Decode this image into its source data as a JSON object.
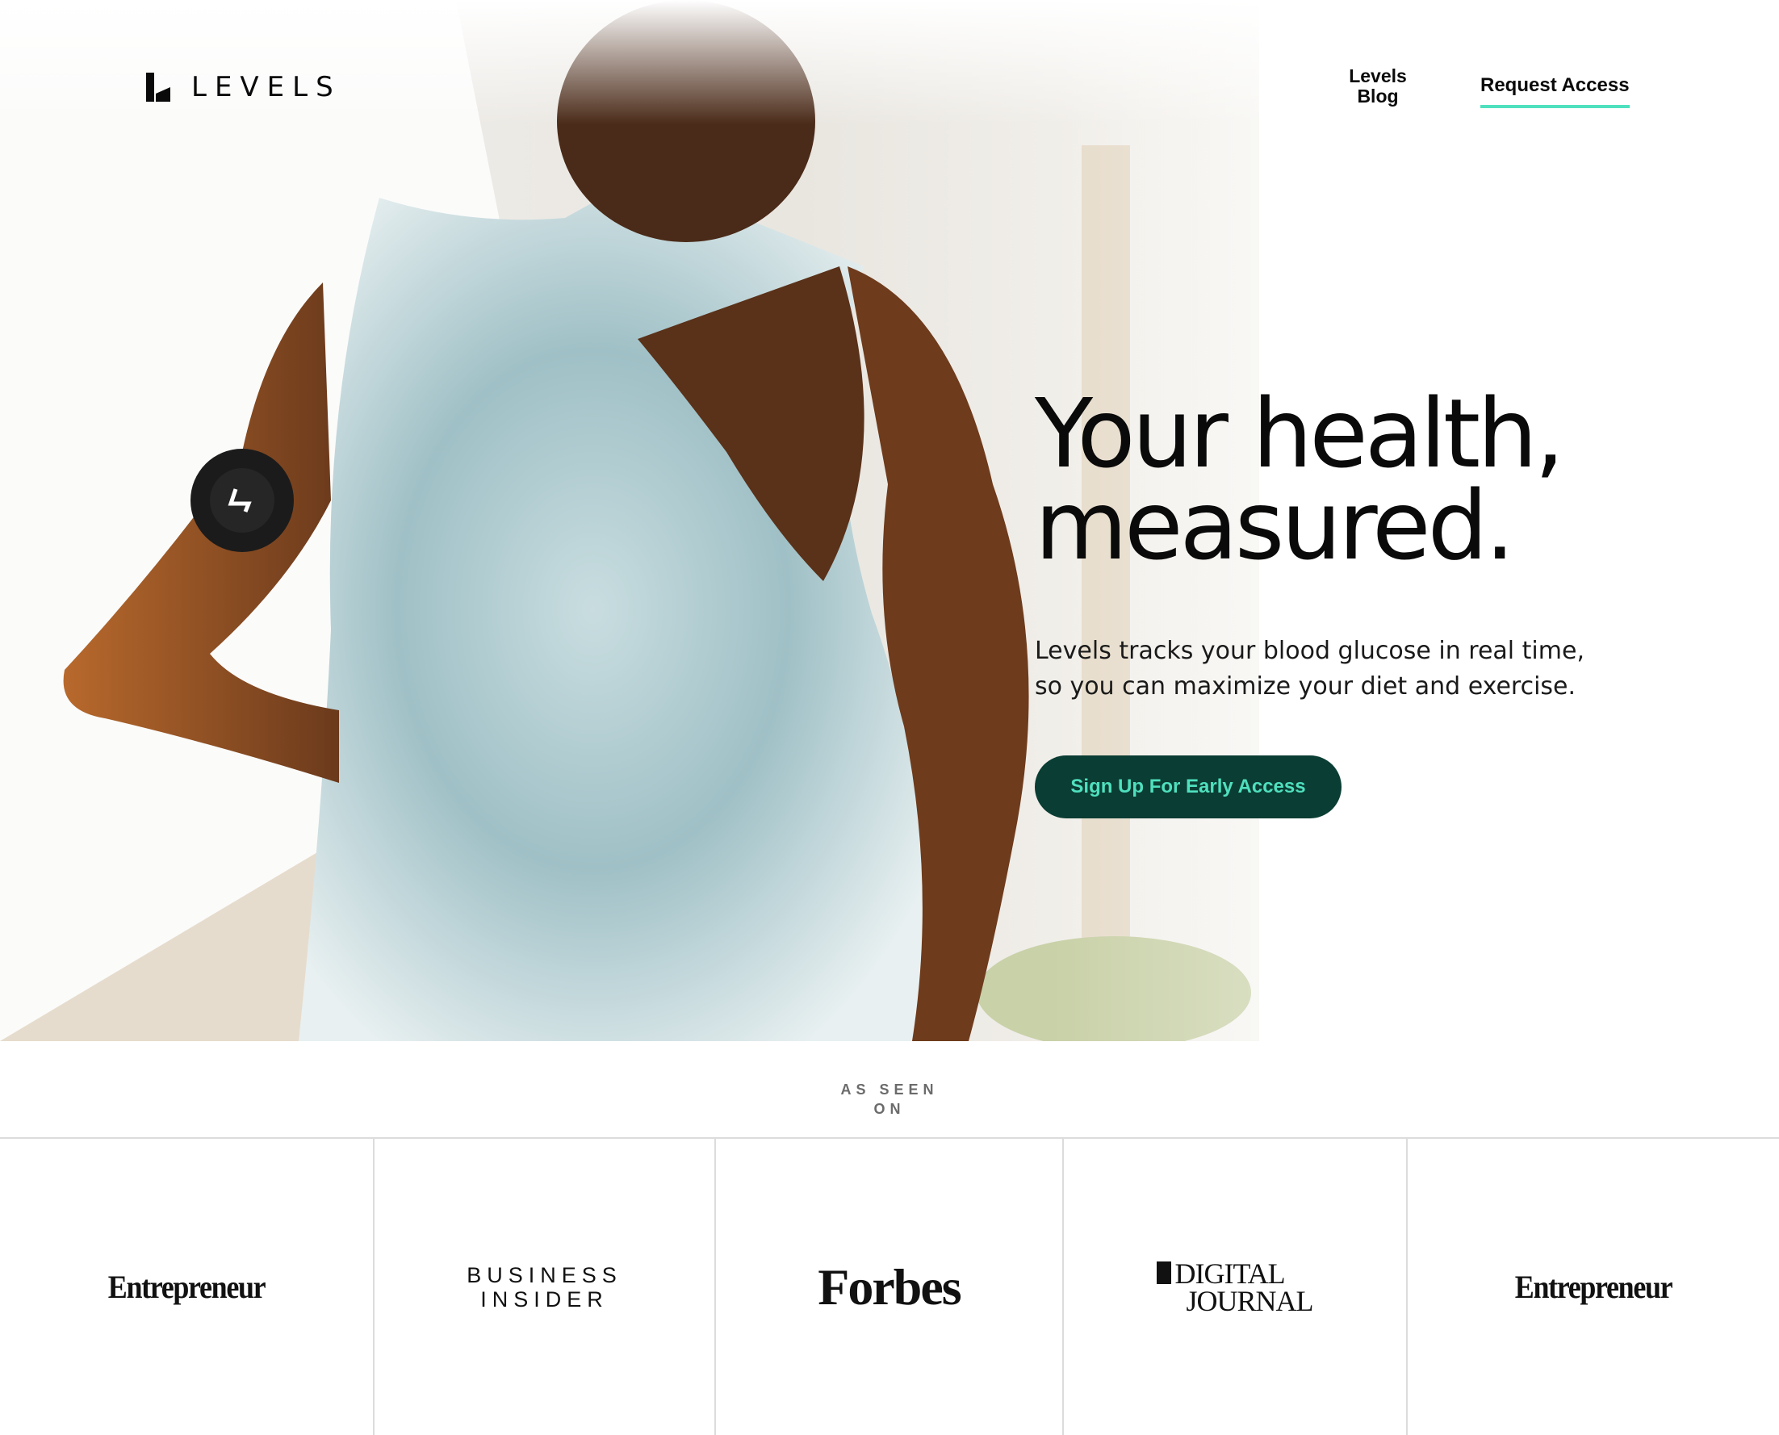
{
  "brand": {
    "name": "LEVELS"
  },
  "nav": {
    "blog_line1": "Levels",
    "blog_line2": "Blog",
    "request_access": "Request Access"
  },
  "hero": {
    "headline_line1": "Your health,",
    "headline_line2": "measured.",
    "subcopy_line1": "Levels tracks your blood glucose in real time,",
    "subcopy_line2": "so you can maximize your diet and exercise.",
    "cta_label": "Sign Up For Early Access"
  },
  "press": {
    "label_line1": "AS SEEN",
    "label_line2": "ON",
    "logos": [
      {
        "name": "Entrepreneur"
      },
      {
        "line1": "BUSINESS",
        "line2": "INSIDER"
      },
      {
        "name": "Forbes"
      },
      {
        "line1": "DIGITAL",
        "line2": "JOURNAL"
      },
      {
        "name": "Entrepreneur"
      }
    ]
  },
  "colors": {
    "accent": "#4fe0be",
    "cta_background": "#0a3d33",
    "text": "#0a0a0a"
  }
}
